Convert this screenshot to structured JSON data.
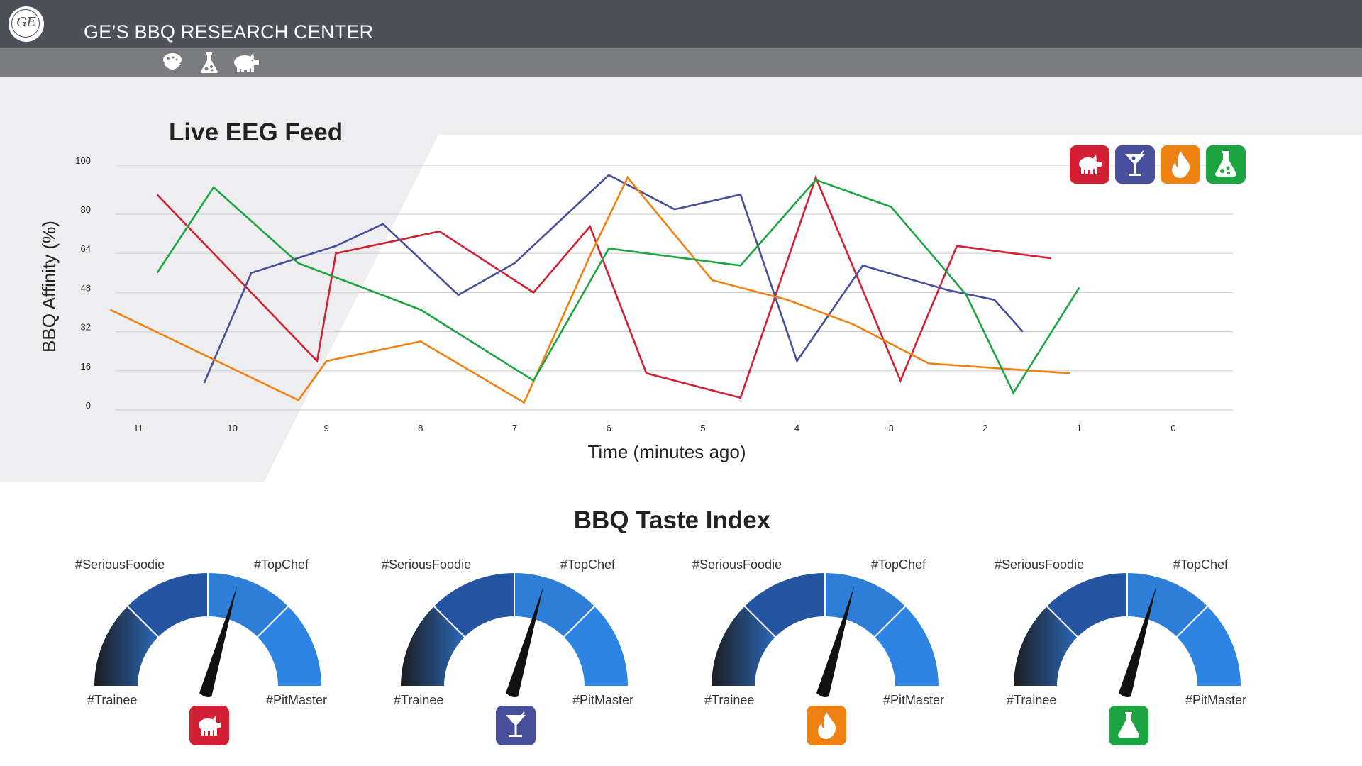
{
  "header": {
    "logo_text": "GE",
    "title": "GE’S BBQ RESEARCH CENTER",
    "nav_icons": [
      "chef-icon",
      "flask-icon",
      "pig-icon"
    ]
  },
  "chart_data": {
    "type": "line",
    "title": "Live EEG Feed",
    "xlabel": "Time (minutes ago)",
    "ylabel": "BBQ Affinity (%)",
    "x_ticks": [
      "11",
      "10",
      "9",
      "8",
      "7",
      "6",
      "5",
      "4",
      "3",
      "2",
      "1",
      "0"
    ],
    "y_ticks": [
      "0",
      "16",
      "32",
      "48",
      "64",
      "80",
      "100"
    ],
    "grid": true,
    "legend_placement": "top-right",
    "legend_icons": [
      "pig-icon",
      "cocktail-icon",
      "flame-icon",
      "flask-icon"
    ],
    "series": [
      {
        "color": "#d31f33",
        "icon": "pig-icon",
        "points": [
          [
            10.8,
            88
          ],
          [
            9.1,
            20
          ],
          [
            8.9,
            64
          ],
          [
            7.8,
            73
          ],
          [
            6.8,
            48
          ],
          [
            6.2,
            75
          ],
          [
            5.6,
            15
          ],
          [
            4.6,
            5
          ],
          [
            3.8,
            95
          ],
          [
            2.9,
            12
          ],
          [
            2.3,
            67
          ],
          [
            1.3,
            62
          ]
        ]
      },
      {
        "color": "#484f9a",
        "icon": "cocktail-icon",
        "points": [
          [
            10.3,
            11
          ],
          [
            9.8,
            56
          ],
          [
            8.9,
            67
          ],
          [
            8.4,
            76
          ],
          [
            7.6,
            47
          ],
          [
            7.0,
            60
          ],
          [
            6.0,
            96
          ],
          [
            5.3,
            82
          ],
          [
            4.6,
            88
          ],
          [
            4.0,
            20
          ],
          [
            3.3,
            59
          ],
          [
            2.4,
            49
          ],
          [
            1.9,
            45
          ],
          [
            1.6,
            32
          ]
        ]
      },
      {
        "color": "#ef8113",
        "icon": "flame-icon",
        "points": [
          [
            11.3,
            41
          ],
          [
            9.3,
            4
          ],
          [
            9.0,
            20
          ],
          [
            8.0,
            28
          ],
          [
            6.9,
            3
          ],
          [
            6.2,
            63
          ],
          [
            5.8,
            95
          ],
          [
            4.9,
            53
          ],
          [
            4.1,
            45
          ],
          [
            3.4,
            35
          ],
          [
            2.6,
            19
          ],
          [
            1.1,
            15
          ]
        ]
      },
      {
        "color": "#1ca541",
        "icon": "flask-icon",
        "points": [
          [
            10.8,
            56
          ],
          [
            10.2,
            91
          ],
          [
            9.3,
            60
          ],
          [
            8.0,
            41
          ],
          [
            6.8,
            12
          ],
          [
            6.0,
            66
          ],
          [
            4.6,
            59
          ],
          [
            3.8,
            94
          ],
          [
            3.0,
            83
          ],
          [
            2.2,
            47
          ],
          [
            1.7,
            7
          ],
          [
            1.0,
            50
          ]
        ]
      }
    ]
  },
  "gauges_section": {
    "title": "BBQ Taste Index",
    "gauges": [
      {
        "icon": "pig-icon",
        "icon_color": "#d31f33",
        "label_top_left": "#SeriousFoodie",
        "label_top_right": "#TopChef",
        "label_bottom_left": "#Trainee",
        "label_bottom_right": "#PitMaster",
        "needle_fraction": 0.59
      },
      {
        "icon": "cocktail-icon",
        "icon_color": "#484f9a",
        "label_top_left": "#SeriousFoodie",
        "label_top_right": "#TopChef",
        "label_bottom_left": "#Trainee",
        "label_bottom_right": "#PitMaster",
        "needle_fraction": 0.59
      },
      {
        "icon": "flame-icon",
        "icon_color": "#ef8113",
        "label_top_left": "#SeriousFoodie",
        "label_top_right": "#TopChef",
        "label_bottom_left": "#Trainee",
        "label_bottom_right": "#PitMaster",
        "needle_fraction": 0.59
      },
      {
        "icon": "flask-icon",
        "icon_color": "#1ca541",
        "label_top_left": "#SeriousFoodie",
        "label_top_right": "#TopChef",
        "label_bottom_left": "#Trainee",
        "label_bottom_right": "#PitMaster",
        "needle_fraction": 0.59
      }
    ]
  }
}
